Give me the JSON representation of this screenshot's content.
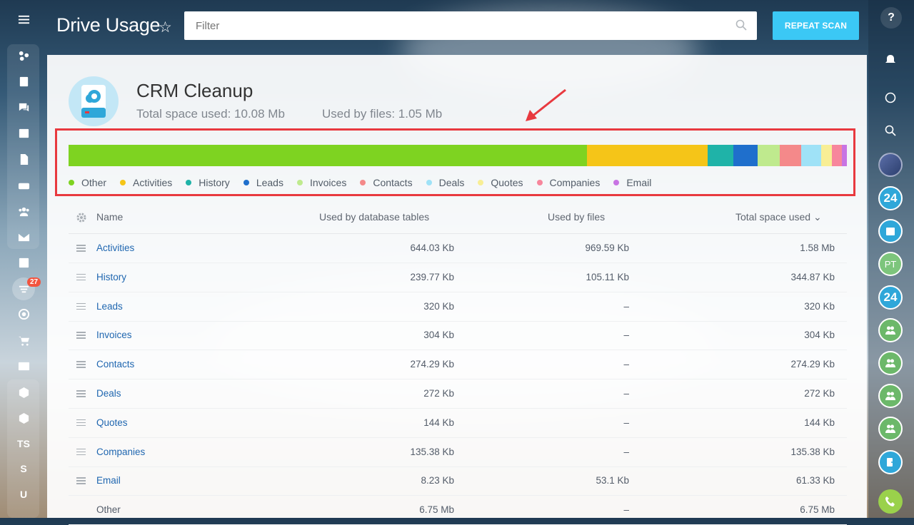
{
  "header": {
    "title": "Drive Usage",
    "filter_placeholder": "Filter",
    "scan_button": "REPEAT SCAN"
  },
  "left_sidebar": {
    "badge_count": "27",
    "text_items": [
      "TS",
      "S",
      "U"
    ]
  },
  "drive": {
    "name": "CRM Cleanup",
    "total_space": "Total space used: 10.08 Mb",
    "files_space": "Used by files: 1.05 Mb"
  },
  "usage_bar": [
    {
      "label": "Other",
      "fraction": 0.667,
      "color": "#7ed321"
    },
    {
      "label": "Activities",
      "fraction": 0.156,
      "color": "#f5c518"
    },
    {
      "label": "History",
      "fraction": 0.033,
      "color": "#1fb3a8"
    },
    {
      "label": "Leads",
      "fraction": 0.031,
      "color": "#1f6fcc"
    },
    {
      "label": "Invoices",
      "fraction": 0.029,
      "color": "#bfea8e"
    },
    {
      "label": "Contacts",
      "fraction": 0.027,
      "color": "#f4898a"
    },
    {
      "label": "Deals",
      "fraction": 0.026,
      "color": "#9fe2f7"
    },
    {
      "label": "Quotes",
      "fraction": 0.014,
      "color": "#f8ee95"
    },
    {
      "label": "Companies",
      "fraction": 0.013,
      "color": "#f7869c"
    },
    {
      "label": "Email",
      "fraction": 0.006,
      "color": "#c874e3"
    }
  ],
  "table": {
    "headers": {
      "name": "Name",
      "db": "Used by database tables",
      "files": "Used by files",
      "total": "Total space used"
    },
    "rows": [
      {
        "name": "Activities",
        "db": "644.03 Kb",
        "files": "969.59 Kb",
        "total": "1.58 Mb",
        "link": true
      },
      {
        "name": "History",
        "db": "239.77 Kb",
        "files": "105.11 Kb",
        "total": "344.87 Kb",
        "link": true
      },
      {
        "name": "Leads",
        "db": "320 Kb",
        "files": "–",
        "total": "320 Kb",
        "link": true
      },
      {
        "name": "Invoices",
        "db": "304 Kb",
        "files": "–",
        "total": "304 Kb",
        "link": true
      },
      {
        "name": "Contacts",
        "db": "274.29 Kb",
        "files": "–",
        "total": "274.29 Kb",
        "link": true
      },
      {
        "name": "Deals",
        "db": "272 Kb",
        "files": "–",
        "total": "272 Kb",
        "link": true
      },
      {
        "name": "Quotes",
        "db": "144 Kb",
        "files": "–",
        "total": "144 Kb",
        "link": true
      },
      {
        "name": "Companies",
        "db": "135.38 Kb",
        "files": "–",
        "total": "135.38 Kb",
        "link": true
      },
      {
        "name": "Email",
        "db": "8.23 Kb",
        "files": "53.1 Kb",
        "total": "61.33 Kb",
        "link": true
      },
      {
        "name": "Other",
        "db": "6.75 Mb",
        "files": "–",
        "total": "6.75 Mb",
        "link": false
      }
    ]
  },
  "right_sidebar": {
    "items": [
      "24",
      "PT",
      "24"
    ]
  }
}
